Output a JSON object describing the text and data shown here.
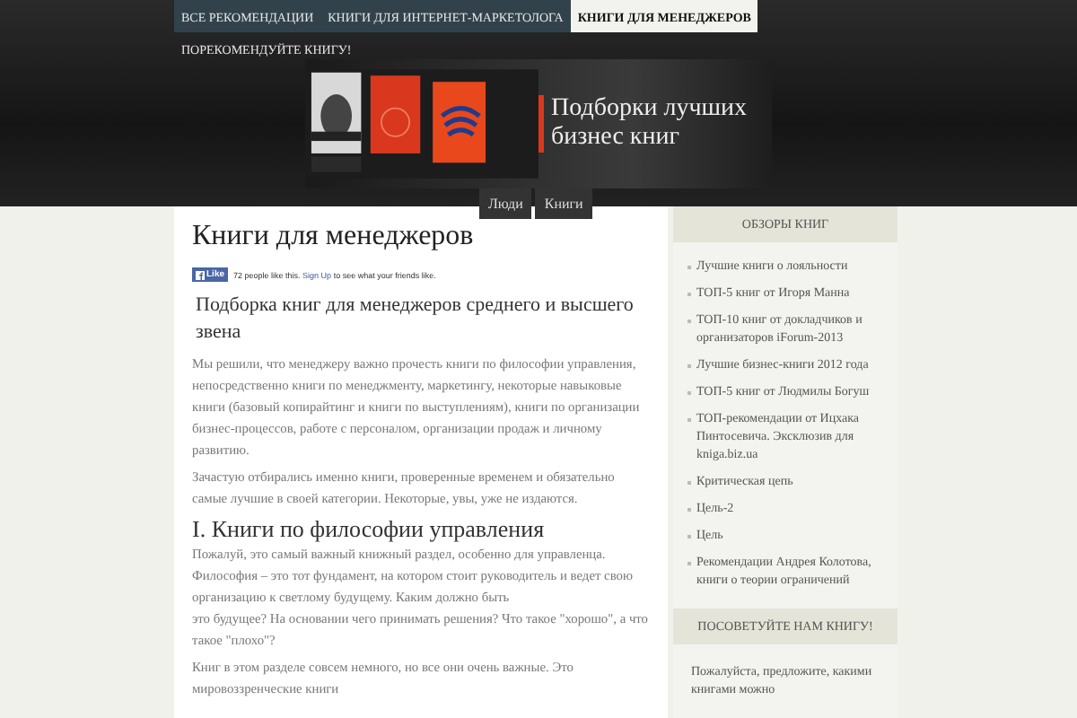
{
  "nav": {
    "tabs": [
      {
        "label": "ВСЕ РЕКОМЕНДАЦИИ",
        "selected": false
      },
      {
        "label": "КНИГИ ДЛЯ ИНТЕРНЕТ-МАРКЕТОЛОГА",
        "selected": false
      },
      {
        "label": "КНИГИ ДЛЯ МЕНЕДЖЕРОВ",
        "selected": true
      },
      {
        "label": "ПОРЕКОМЕНДУЙТЕ КНИГУ!",
        "selected": false
      }
    ]
  },
  "banner": {
    "heading": "Подборки лучших бизнес книг",
    "subnav": [
      {
        "label": "Люди"
      },
      {
        "label": "Книги"
      }
    ]
  },
  "article": {
    "title": "Книги для менеджеров",
    "like": {
      "button": "Like",
      "text": "72 people like this.",
      "link": "Sign Up",
      "after": "to see what your friends like."
    },
    "subtitle": "Подборка книг для менеджеров среднего и высшего звена",
    "intro": [
      "Мы решили, что менеджеру важно прочесть книги по философии управления, непосредственно книги по менеджменту, маркетингу, некоторые навыковые книги (базовый копирайтинг и книги по выступлениям), книги по организации бизнес-процессов, работе с персоналом, организации продаж и личному развитию.",
      "Зачастую отбирались именно книги, проверенные временем и обязательно самые лучшие в своей категории. Некоторые, увы, уже не издаются."
    ],
    "section": "I. Книги по философии управления",
    "section_text": [
      "Пожалуй, это самый важный книжный раздел, особенно для управленца. Философия – это тот фундамент, на котором стоит руководитель и ведет свою организацию к светлому будущему. Каким должно быть",
      "это будущее? На основании чего принимать решения? Что такое \"хорошо\", а что такое \"плохо\"?",
      "Книг в этом разделе совсем немного, но все они очень важные. Это мировоззренческие книги"
    ]
  },
  "sidebar": {
    "reviews_title": "ОБЗОРЫ КНИГ",
    "reviews": [
      "Лучшие книги о лояльности",
      "ТОП-5 книг от Игоря Манна",
      "ТОП-10 книг от докладчиков и организаторов iForum-2013",
      "Лучшие бизнес-книги 2012 года",
      "ТОП-5 книг от Людмилы Богуш",
      "ТОП-рекомендации от Ицхака Пинтосевича. Эксклюзив для kniga.biz.ua",
      "Критическая цепь",
      "Цель-2",
      "Цель",
      "Рекомендации Андрея Колотова, книги о теории ограничений"
    ],
    "suggest_title": "ПОСОВЕТУЙТЕ НАМ КНИГУ!",
    "suggest_text": "Пожалуйста, предложите, какими книгами можно"
  }
}
